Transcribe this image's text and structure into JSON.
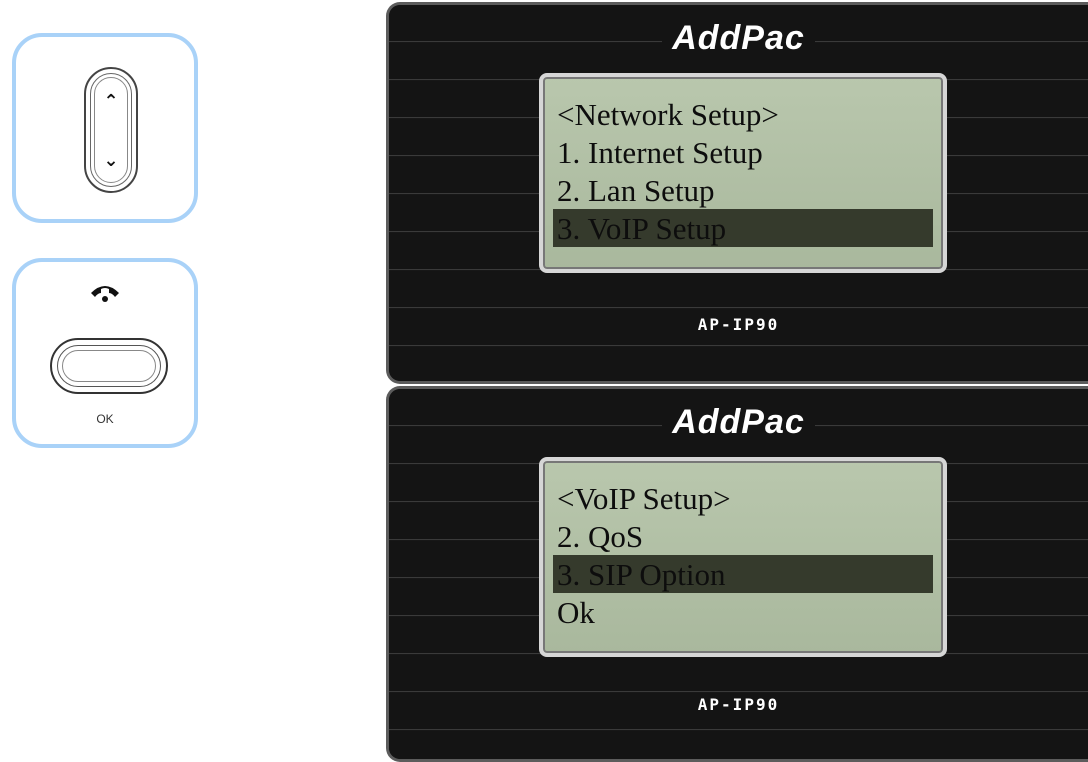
{
  "nav_key": {
    "up_glyph": "︿",
    "down_glyph": "﹀"
  },
  "ok_key": {
    "icon": "phone-handset-icon",
    "handset_glyph": "☎",
    "label": "OK"
  },
  "screens": [
    {
      "brand": "AddPac",
      "model": "AP-IP90",
      "lines": [
        "<Network Setup>",
        "1. Internet Setup",
        "2. Lan Setup",
        "3. VoIP Setup"
      ],
      "selected_line": "3. VoIP Setup"
    },
    {
      "brand": "AddPac",
      "model": "AP-IP90",
      "lines": [
        "<VoIP Setup>",
        "2. QoS",
        "3. SIP Option",
        "Ok"
      ],
      "selected_line": "3. SIP Option"
    }
  ],
  "colors": {
    "card_border": "#a9d2f8",
    "lcd_bg": "#b9c7ad",
    "lcd_highlight": "#353a2c",
    "bezel": "#121212"
  }
}
